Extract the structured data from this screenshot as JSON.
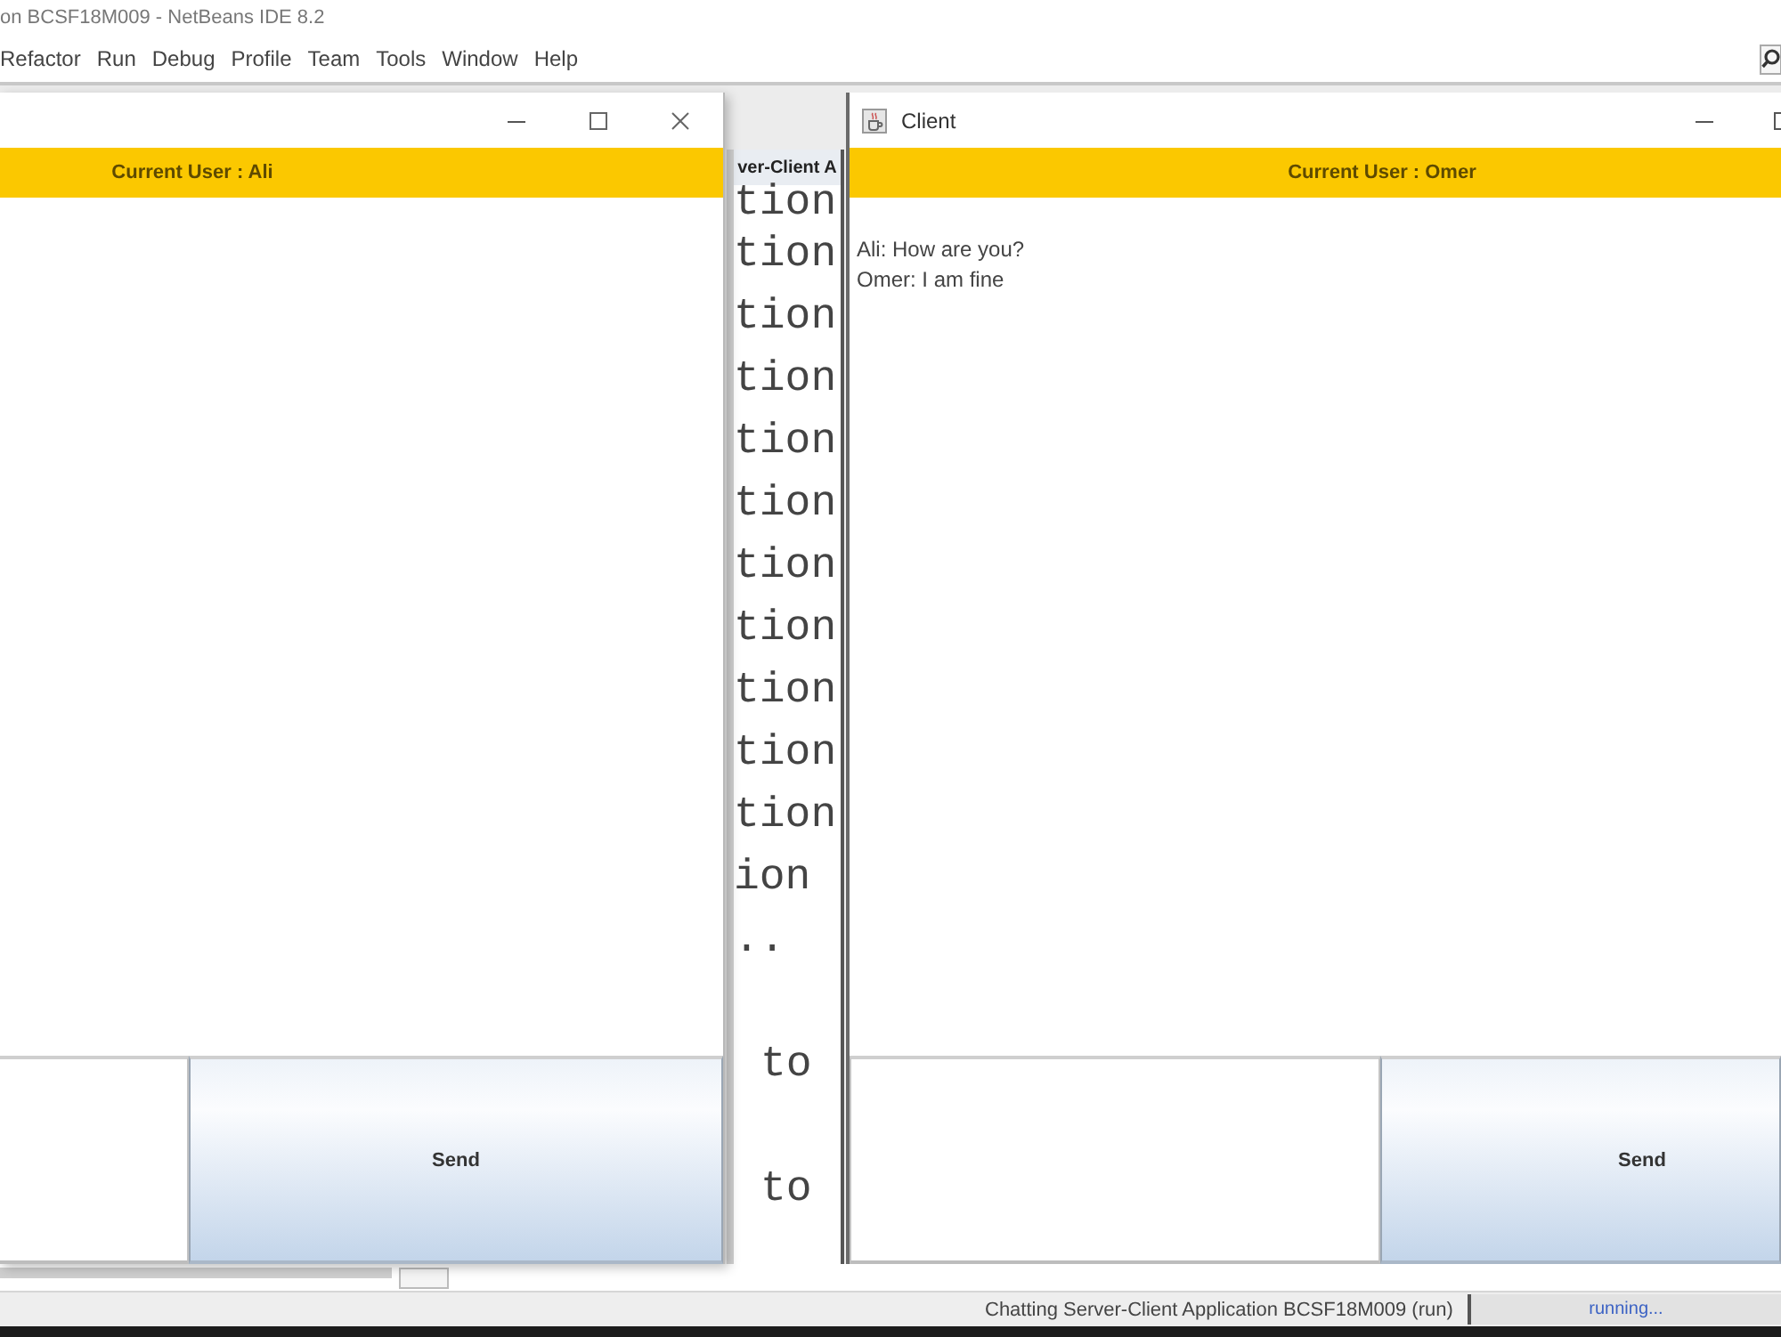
{
  "ide": {
    "title": "on BCSF18M009 - NetBeans IDE 8.2",
    "menu": [
      "Refactor",
      "Run",
      "Debug",
      "Profile",
      "Team",
      "Tools",
      "Window",
      "Help"
    ],
    "editor": {
      "tab": "ver-Client A",
      "paragraphs": [
        [
          {
            "text": "tion",
            "indented": false
          },
          {
            "text": "tion",
            "indented": false
          },
          {
            "text": "tion",
            "indented": false
          },
          {
            "text": "tion",
            "indented": false
          },
          {
            "text": "tion",
            "indented": false
          },
          {
            "text": "tion",
            "indented": false
          },
          {
            "text": "tion",
            "indented": false
          },
          {
            "text": "tion",
            "indented": false
          },
          {
            "text": "tion",
            "indented": false
          },
          {
            "text": "tion",
            "indented": false
          },
          {
            "text": "tion",
            "indented": false
          },
          {
            "text": "ion",
            "indented": false
          },
          {
            "text": "..",
            "indented": false
          }
        ],
        [
          {
            "text": "to",
            "indented": true
          }
        ],
        [
          {
            "text": "to",
            "indented": true
          }
        ]
      ]
    },
    "status_bar": {
      "task": "Chatting Server-Client Application BCSF18M009 (run)",
      "progress": "running..."
    }
  },
  "windows": [
    {
      "current_user": "Current User : Ali",
      "send": "Send"
    },
    {
      "title": "Client",
      "current_user": "Current User : Omer",
      "messages": [
        "Ali: How are you?",
        "Omer: I am fine"
      ],
      "send": "Send"
    }
  ]
}
